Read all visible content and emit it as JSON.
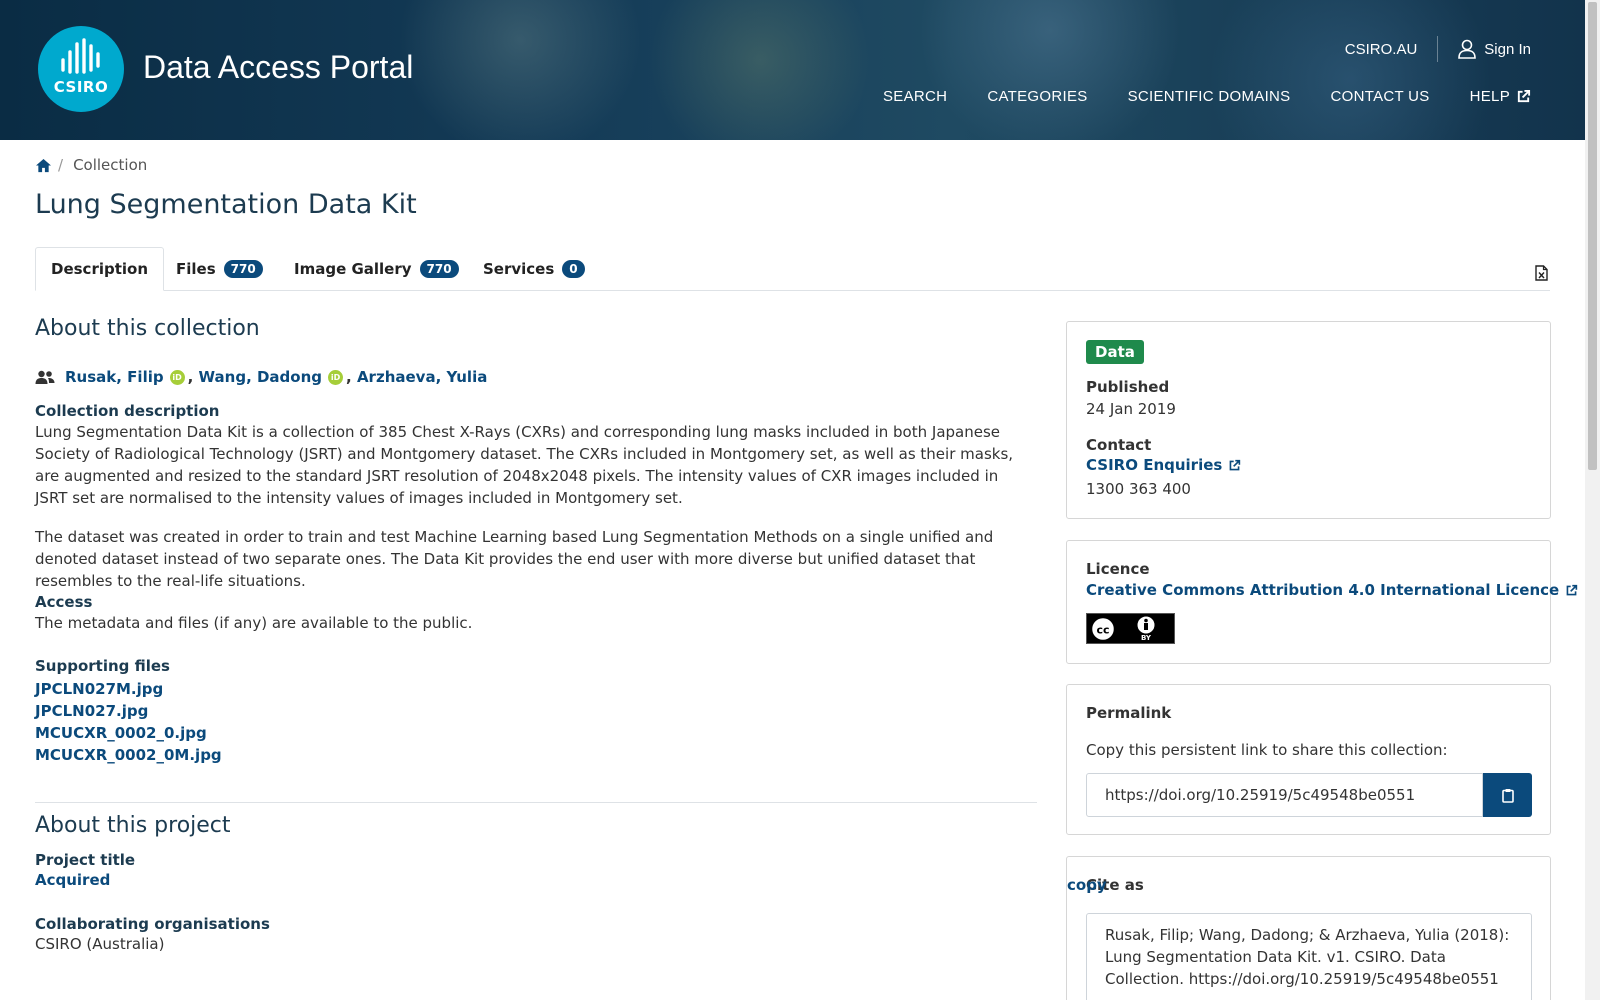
{
  "header": {
    "logo_text": "CSIRO",
    "site_title": "Data Access Portal",
    "top_links": {
      "csiro": "CSIRO.AU",
      "sign_in": "Sign In"
    },
    "nav": [
      "SEARCH",
      "CATEGORIES",
      "SCIENTIFIC DOMAINS",
      "CONTACT US",
      "HELP"
    ]
  },
  "breadcrumb": {
    "current": "Collection"
  },
  "page_title": "Lung Segmentation Data Kit",
  "tabs": [
    {
      "label": "Description"
    },
    {
      "label": "Files",
      "count": "770"
    },
    {
      "label": "Image Gallery",
      "count": "770"
    },
    {
      "label": "Services",
      "count": "0"
    }
  ],
  "about_collection": {
    "heading": "About this collection",
    "authors": [
      "Rusak, Filip",
      "Wang, Dadong",
      "Arzhaeva, Yulia"
    ],
    "orcid_label": "iD",
    "description_label": "Collection description",
    "description_p1": "Lung Segmentation Data Kit is a collection of 385 Chest X-Rays (CXRs) and corresponding lung masks included in both Japanese Society of Radiological Technology (JSRT) and Montgomery dataset. The CXRs included in Montgomery set, as well as their masks, are augmented and resized to the standard JSRT resolution of 2048x2048 pixels. The intensity values of CXR images included in JSRT set are normalised to the intensity values of images included in Montgomery set.",
    "description_p2": "The dataset was created in order to train and test Machine Learning based Lung Segmentation Methods on a single unified and denoted dataset instead of two separate ones. The Data Kit provides the end user with more diverse but unified dataset that resembles to the real-life situations.",
    "access_label": "Access",
    "access_text": "The metadata and files (if any) are available to the public.",
    "supporting_label": "Supporting files",
    "supporting_files": [
      "JPCLN027M.jpg",
      "JPCLN027.jpg",
      "MCUCXR_0002_0.jpg",
      "MCUCXR_0002_0M.jpg"
    ]
  },
  "about_project": {
    "heading": "About this project",
    "title_label": "Project title",
    "title_value": "Acquired",
    "collab_label": "Collaborating organisations",
    "collab_value": "CSIRO (Australia)"
  },
  "sidebar": {
    "type_pill": "Data",
    "published_label": "Published",
    "published_value": "24 Jan 2019",
    "contact_label": "Contact",
    "contact_link": "CSIRO Enquiries",
    "contact_phone": "1300 363 400",
    "licence_label": "Licence",
    "licence_link": "Creative Commons Attribution 4.0 International Licence",
    "cc_badge_text": "BY",
    "permalink_label": "Permalink",
    "permalink_hint": "Copy this persistent link to share this collection:",
    "permalink_url": "https://doi.org/10.25919/5c49548be0551",
    "cite_label": "Cite as",
    "cite_copy": "copy",
    "cite_text": "Rusak, Filip; Wang, Dadong; & Arzhaeva, Yulia (2018): Lung Segmentation Data Kit. v1. CSIRO. Data Collection. https://doi.org/10.25919/5c49548be0551"
  },
  "colors": {
    "brand_blue": "#0b4a7c",
    "csiro_cyan": "#00a9ce",
    "data_green": "#1f8a4c",
    "orcid_green": "#a6ce39"
  }
}
